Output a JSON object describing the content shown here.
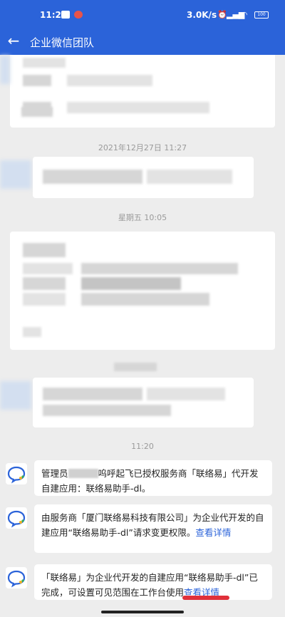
{
  "status": {
    "time": "11:24",
    "net": "3.0K/s",
    "signal": "⏰ ▐▐ ☈",
    "battery": "100"
  },
  "header": {
    "title": "企业微信团队",
    "back_label": "←"
  },
  "timestamps": [
    "2021年12月27日 11:27",
    "星期五 10:05",
    "11:20"
  ],
  "messages": [
    {
      "parts": [
        "管理员",
        "",
        "呜呼起飞已授权服务商「联络易」代开发自建应用：联络易助手-dl。"
      ]
    },
    {
      "text": "由服务商「厦门联络易科技有限公司」为企业代开发的自建应用“联络易助手-dl”请求变更权限。",
      "link": "查看详情"
    },
    {
      "text": "「联络易」为企业代开发的自建应用“联络易助手-dl”已完成，可设置可见范围在工作台使用",
      "link": "查看详情"
    }
  ],
  "colors": {
    "header_bg": "#2b63d9",
    "link": "#2b63d9",
    "highlight": "#e0303a"
  },
  "icons": [
    "back-arrow-icon",
    "wecom-logo-icon"
  ]
}
